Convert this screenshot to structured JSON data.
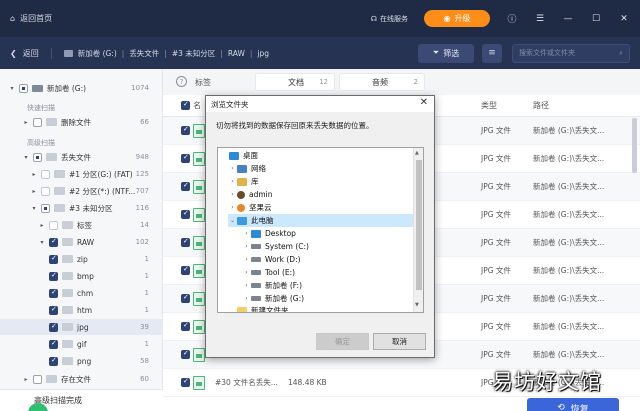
{
  "titlebar": {
    "home_label": "返回首页",
    "service_label": "在线服务",
    "upgrade_label": "升级"
  },
  "toolbar": {
    "back_label": "返回",
    "breadcrumbs": [
      "新加卷 (G:)",
      "丢失文件",
      "#3 未知分区",
      "RAW",
      "jpg"
    ],
    "filter_label": "筛选",
    "search_placeholder": "搜索文件或文件夹"
  },
  "sidebar": {
    "drive": {
      "label": "新加卷 (G:)",
      "count": "1074"
    },
    "quick_scan_label": "快速扫描",
    "deleted": {
      "label": "删除文件",
      "count": "66"
    },
    "advanced_scan_label": "高级扫描",
    "lost": {
      "label": "丢失文件",
      "count": "948"
    },
    "partitions": [
      {
        "label": "#1 分区(G:) (FAT)",
        "count": "125"
      },
      {
        "label": "#2 分区(*:) (NTF...",
        "count": "707"
      },
      {
        "label": "#3 未知分区",
        "count": "116"
      }
    ],
    "tags": {
      "label": "标签",
      "count": "14"
    },
    "raw": {
      "label": "RAW",
      "count": "102"
    },
    "formats": [
      {
        "label": "zip",
        "count": "1"
      },
      {
        "label": "bmp",
        "count": "1"
      },
      {
        "label": "chm",
        "count": "1"
      },
      {
        "label": "htm",
        "count": "1"
      },
      {
        "label": "jpg",
        "count": "39"
      },
      {
        "label": "gif",
        "count": "1"
      },
      {
        "label": "png",
        "count": "58"
      }
    ],
    "existing": {
      "label": "存在文件",
      "count": "60"
    },
    "status_label": "高级扫描完成"
  },
  "main": {
    "tags_label": "标签",
    "tabs": [
      {
        "label": "文档",
        "count": "12"
      },
      {
        "label": "音频",
        "count": "2"
      }
    ],
    "columns": {
      "name": "名",
      "type": "类型",
      "path": "路径"
    },
    "rows": [
      {
        "type": "JPG 文件",
        "path": "新加卷 (G:)\\丢失文..."
      },
      {
        "type": "JPG 文件",
        "path": "新加卷 (G:)\\丢失文..."
      },
      {
        "type": "JPG 文件",
        "path": "新加卷 (G:)\\丢失文..."
      },
      {
        "type": "JPG 文件",
        "path": "新加卷 (G:)\\丢失文..."
      },
      {
        "type": "JPG 文件",
        "path": "新加卷 (G:)\\丢失文..."
      },
      {
        "type": "JPG 文件",
        "path": "新加卷 (G:)\\丢失文..."
      },
      {
        "type": "JPG 文件",
        "path": "新加卷 (G:)\\丢失文..."
      },
      {
        "type": "JPG 文件",
        "path": "新加卷 (G:)\\丢失文..."
      },
      {
        "type": "JPG 文件",
        "path": "新加卷 (G:)\\丢失文..."
      },
      {
        "name": "#30 文件名丢失...",
        "size": "148.48 KB",
        "type": "JPG 文件",
        "path": "新加卷 (G:)\\丢失文..."
      }
    ],
    "recover_label": "恢复"
  },
  "dialog": {
    "title": "浏览文件夹",
    "message": "切勿将找到的数据保存回原来丢失数据的位置。",
    "tree": [
      {
        "label": "桌面",
        "icon": "desktop-icon"
      },
      {
        "label": "网络",
        "icon": "network-icon"
      },
      {
        "label": "库",
        "icon": "library-icon"
      },
      {
        "label": "admin",
        "icon": "user-icon"
      },
      {
        "label": "坚果云",
        "icon": "cloud-icon"
      },
      {
        "label": "此电脑",
        "icon": "computer-icon"
      },
      {
        "label": "Desktop",
        "icon": "desktop-icon"
      },
      {
        "label": "System (C:)",
        "icon": "drive-icon"
      },
      {
        "label": "Work (D:)",
        "icon": "drive-icon"
      },
      {
        "label": "Tool (E:)",
        "icon": "drive-icon"
      },
      {
        "label": "新加卷 (F:)",
        "icon": "drive-icon"
      },
      {
        "label": "新加卷 (G:)",
        "icon": "drive-icon"
      },
      {
        "label": "新建文件夹",
        "icon": "folder-icon"
      }
    ],
    "ok_label": "确定",
    "cancel_label": "取消"
  },
  "watermark": "易坊好文馆",
  "colors": {
    "titlebar": "#1f2a44",
    "toolbar": "#263352",
    "accent": "#ff8d1a",
    "primary": "#3a66d9",
    "checkbox": "#2f4476"
  }
}
